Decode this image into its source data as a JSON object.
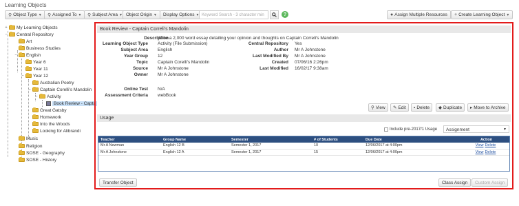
{
  "app": {
    "title": "Learning Objects"
  },
  "toolbar": {
    "filters": [
      "Object Type",
      "Assigned To",
      "Subject Area",
      "Object Origin",
      "Display Options"
    ],
    "search_placeholder": "Keyword Search - 3 character min",
    "help_label": "?",
    "assign_multiple": "Assign Multiple Resources",
    "create": "Create Learning Object"
  },
  "tree": {
    "items": [
      {
        "label": "My Learning Objects",
        "toggle": "+",
        "icon": "folder"
      },
      {
        "label": "Central Repository",
        "toggle": "−",
        "icon": "folder"
      },
      {
        "label": "Art",
        "toggle": "",
        "icon": "folder"
      },
      {
        "label": "Business Studies",
        "toggle": "",
        "icon": "folder"
      },
      {
        "label": "English",
        "toggle": "−",
        "icon": "folder"
      },
      {
        "label": "Year 6",
        "toggle": "",
        "icon": "folder"
      },
      {
        "label": "Year 11",
        "toggle": "",
        "icon": "folder"
      },
      {
        "label": "Year 12",
        "toggle": "−",
        "icon": "folder"
      },
      {
        "label": "Australian Poetry",
        "toggle": "",
        "icon": "folder"
      },
      {
        "label": "Captain Corelli's Mandolin",
        "toggle": "−",
        "icon": "folder"
      },
      {
        "label": "Activity",
        "toggle": "−",
        "icon": "folder"
      },
      {
        "label": "Book Review - Capta",
        "toggle": "",
        "icon": "doc",
        "selected": true
      },
      {
        "label": "Great Gatsby",
        "toggle": "",
        "icon": "folder"
      },
      {
        "label": "Homework",
        "toggle": "",
        "icon": "folder"
      },
      {
        "label": "Into the Woods",
        "toggle": "",
        "icon": "folder"
      },
      {
        "label": "Looking for Alibrandi",
        "toggle": "",
        "icon": "folder"
      },
      {
        "label": "Music",
        "toggle": "",
        "icon": "folder"
      },
      {
        "label": "Religion",
        "toggle": "",
        "icon": "folder"
      },
      {
        "label": "SOSE - Geography",
        "toggle": "",
        "icon": "folder"
      },
      {
        "label": "SOSE - History",
        "toggle": "",
        "icon": "folder"
      }
    ]
  },
  "detail": {
    "header": "Book Review - Captain Correli's Mandolin",
    "left": [
      {
        "k": "Description",
        "v": "Write a 2,000 word essay detailing your opinion and thoughts on Captain Correli's Mandolin"
      },
      {
        "k": "Learning Object Type",
        "v": "Activity (File Submission)"
      },
      {
        "k": "Subject Area",
        "v": "English"
      },
      {
        "k": "Year Group",
        "v": "12"
      },
      {
        "k": "Topic",
        "v": "Captain Corelli's Mandolin"
      },
      {
        "k": "Source",
        "v": "Mr A Johnstone"
      },
      {
        "k": "Owner",
        "v": "Mr A Johnstone"
      }
    ],
    "right": [
      {
        "k": "Central Repository",
        "v": "Yes"
      },
      {
        "k": "Author",
        "v": "Mr A Johnstone"
      },
      {
        "k": "Last Modified By",
        "v": "Mr A Johnstone"
      },
      {
        "k": "Created",
        "v": "07/06/16 2:26pm"
      },
      {
        "k": "Last Modified",
        "v": "16/02/17 9:38am"
      }
    ],
    "extra": [
      {
        "k": "Online Test",
        "v": "N/A"
      },
      {
        "k": "Assessment Criteria",
        "v": "webBook"
      }
    ],
    "actions": [
      "View",
      "Edit",
      "Delete",
      "Duplicate",
      "Move to Archive"
    ]
  },
  "usage": {
    "title": "Usage",
    "checkbox_label": "Include pre-2017/1 Usage",
    "select_value": "Assignment",
    "columns": [
      "Teacher",
      "Group Name",
      "Semester",
      "# of Students",
      "Due Date",
      "Action"
    ],
    "rows": [
      {
        "teacher": "Mr A Newman",
        "group": "English 12 B",
        "semester": "Semester 1, 2017",
        "students": "10",
        "due": "12/06/2017 at 4:00pm",
        "view": "View",
        "delete": "Delete"
      },
      {
        "teacher": "Mr A Johnstone",
        "group": "English 12 A",
        "semester": "Semester 1, 2017",
        "students": "15",
        "due": "12/06/2017 at 4:00pm",
        "view": "View",
        "delete": "Delete"
      }
    ]
  },
  "footer": {
    "transfer": "Transfer Object",
    "class_assign": "Class Assign",
    "custom_assign": "Custom Assign"
  }
}
